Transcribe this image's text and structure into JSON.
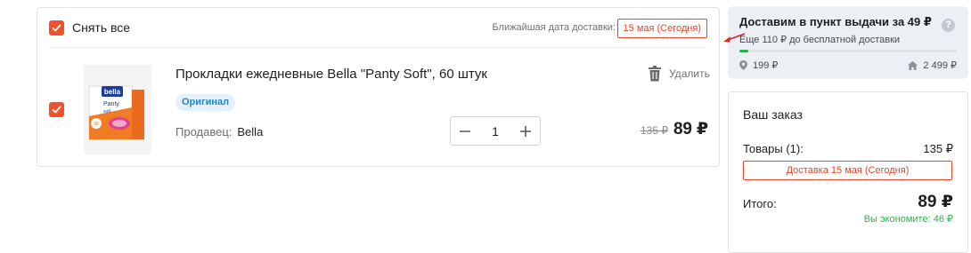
{
  "cart": {
    "select_all_label": "Снять все",
    "nearest_delivery_label": "Ближайшая дата доставки:",
    "nearest_delivery_value": "15 мая (Сегодня)",
    "item": {
      "title": "Прокладки ежедневные Bella \"Panty Soft\", 60 штук",
      "original_badge": "Оригинал",
      "seller_label": "Продавец:",
      "seller_name": "Bella",
      "quantity": "1",
      "delete_label": "Удалить",
      "old_price": "135 ₽",
      "price": "89 ₽",
      "image_icon": "bella-panty-soft-package",
      "package_brand": "bella",
      "package_name": "Panty",
      "package_sub": "soft",
      "package_count": "60"
    }
  },
  "promo": {
    "title": "Доставим в пункт выдачи за 49 ₽",
    "subtitle": "Еще 110 ₽ до бесплатной доставки",
    "help_icon": "?",
    "progress": 0.04,
    "left_value": "199 ₽",
    "right_value": "2 499 ₽"
  },
  "summary": {
    "title": "Ваш заказ",
    "goods_label": "Товары (1):",
    "goods_value": "135 ₽",
    "delivery_badge": "Доставка 15 мая (Сегодня)",
    "total_label": "Итого:",
    "total_value": "89 ₽",
    "savings": "Вы экономите: 46 ₽"
  },
  "colors": {
    "accent": "#f1502f",
    "badge_red": "#e8462b",
    "success_green": "#2ab54a",
    "original_badge_text": "#1f87c8"
  }
}
